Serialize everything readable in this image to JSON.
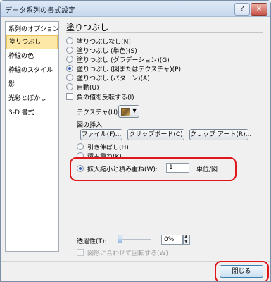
{
  "window": {
    "title": "データ系列の書式設定",
    "help_label": "?",
    "close_label": "×"
  },
  "nav": {
    "items": [
      {
        "label": "系列のオプション",
        "selected": false
      },
      {
        "label": "塗りつぶし",
        "selected": true
      },
      {
        "label": "枠線の色",
        "selected": false
      },
      {
        "label": "枠線のスタイル",
        "selected": false
      },
      {
        "label": "影",
        "selected": false
      },
      {
        "label": "光彩とぼかし",
        "selected": false
      },
      {
        "label": "3-D 書式",
        "selected": false
      }
    ]
  },
  "fill": {
    "heading": "塗りつぶし",
    "options": [
      {
        "label": "塗りつぶしなし(N)",
        "selected": false
      },
      {
        "label": "塗りつぶし (単色)(S)",
        "selected": false
      },
      {
        "label": "塗りつぶし (グラデーション)(G)",
        "selected": false
      },
      {
        "label": "塗りつぶし (図またはテクスチャ)(P)",
        "selected": true
      },
      {
        "label": "塗りつぶし (パターン)(A)",
        "selected": false
      },
      {
        "label": "自動(U)",
        "selected": false
      }
    ],
    "invert_negative_label": "負の値を反転する(I)",
    "texture_label": "テクスチャ(U):",
    "insert_from_label": "図の挿入:",
    "file_button": "ファイル(F)...",
    "clipboard_button": "クリップボード(C)",
    "clipart_button": "クリップ アート(R)...",
    "stretch_label": "引き伸ばし(H)",
    "stack_label": "積み重ね(K)",
    "stack_scale_label": "拡大縮小と積み重ね(W):",
    "stack_scale_value": "1",
    "unit_label": "単位/図",
    "transparency_label": "透過性(T):",
    "transparency_value": "0%",
    "transparency_level": 0,
    "rotate_with_shape_label": "図形に合わせて回転する(W)"
  },
  "footer": {
    "close_button": "閉じる"
  },
  "colors": {
    "selection": "#fde8a8",
    "highlight_outline": "#e0161b"
  }
}
